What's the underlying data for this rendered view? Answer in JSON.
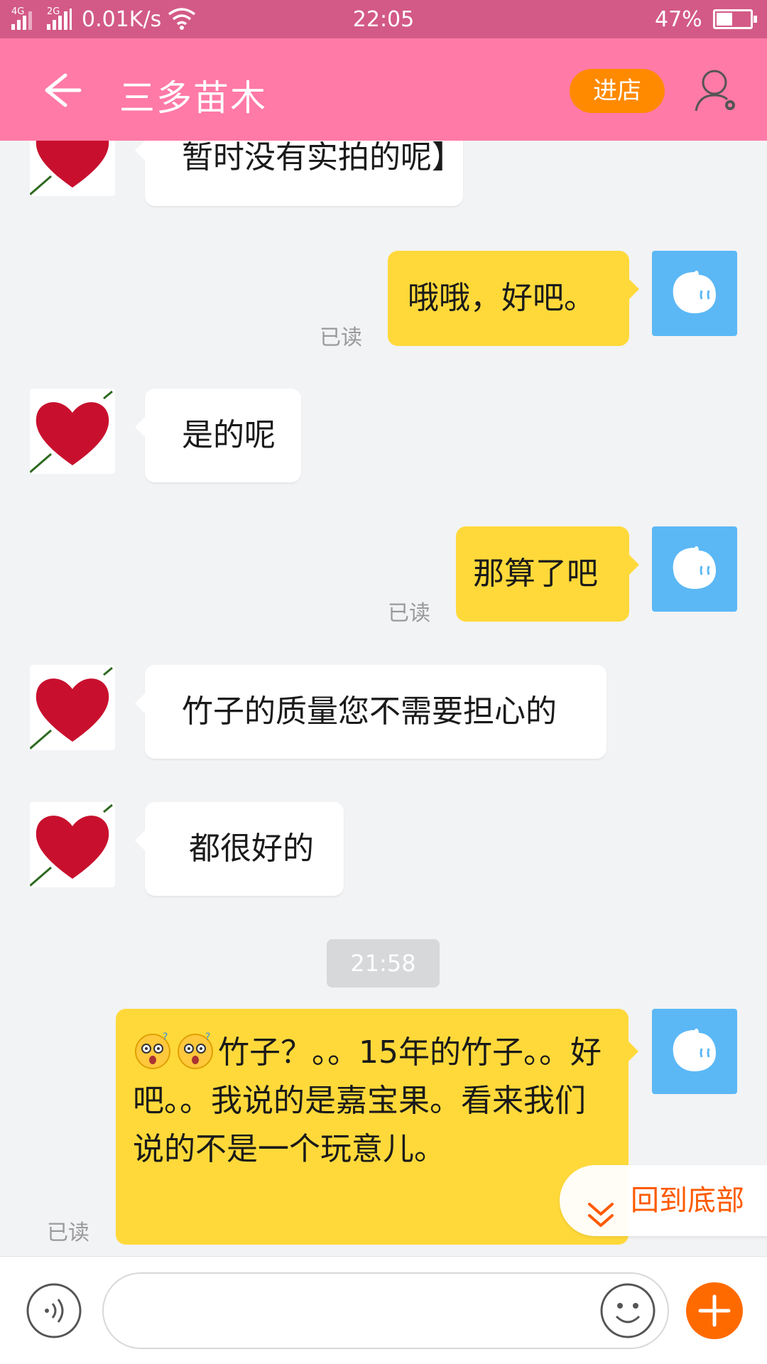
{
  "status_bar": {
    "net1": "4G",
    "net2": "2G",
    "speed": "0.01K/s",
    "time": "22:05",
    "battery": "47%"
  },
  "header": {
    "title": "三多苗木",
    "shop_button": "进店"
  },
  "messages": [
    {
      "side": "in",
      "text": "暂时没有实拍的呢】"
    },
    {
      "side": "out",
      "text": "哦哦，好吧。",
      "status": "已读"
    },
    {
      "side": "in",
      "text": "是的呢"
    },
    {
      "side": "out",
      "text": "那算了吧",
      "status": "已读"
    },
    {
      "side": "in",
      "text": "竹子的质量您不需要担心的"
    },
    {
      "side": "in",
      "text": "都很好的"
    }
  ],
  "timestamp": "21:58",
  "last_message": {
    "text": "竹子？。。15年的竹子。。好吧。。我说的是嘉宝果。看来我们说的不是一个玩意儿。",
    "emojis": [
      "dizzy-face-icon",
      "dizzy-face-icon"
    ],
    "status": "已读"
  },
  "back_to_bottom": "回到底部",
  "input": {
    "placeholder": ""
  },
  "colors": {
    "header": "#ff7aa6",
    "status_bar": "#d35a86",
    "shop_button": "#ff8a00",
    "outgoing_bubble": "#ffd93a",
    "self_avatar": "#5bb8f5"
  }
}
